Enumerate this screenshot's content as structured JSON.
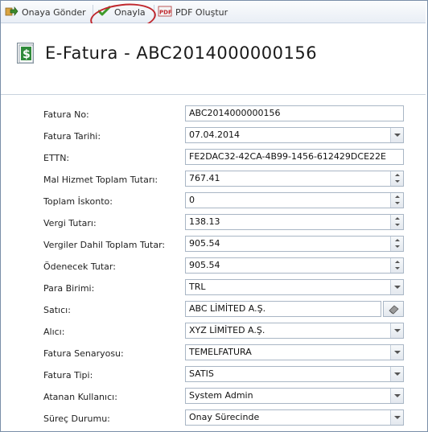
{
  "toolbar": {
    "send_label": "Onaya Gönder",
    "approve_label": "Onayla",
    "pdf_label": "PDF Oluştur"
  },
  "header": {
    "title": "E-Fatura - ABC2014000000156"
  },
  "form": {
    "fields": [
      {
        "label": "Fatura No:",
        "value": "ABC2014000000156",
        "control": "text"
      },
      {
        "label": "Fatura Tarihi:",
        "value": "07.04.2014",
        "control": "date-dropdown"
      },
      {
        "label": "ETTN:",
        "value": "FE2DAC32-42CA-4B99-1456-612429DCE22E",
        "control": "text"
      },
      {
        "label": "Mal Hizmet Toplam Tutarı:",
        "value": "767.41",
        "control": "numeric"
      },
      {
        "label": "Toplam İskonto:",
        "value": "0",
        "control": "numeric"
      },
      {
        "label": "Vergi Tutarı:",
        "value": "138.13",
        "control": "numeric"
      },
      {
        "label": "Vergiler Dahil Toplam Tutar:",
        "value": "905.54",
        "control": "numeric"
      },
      {
        "label": "Ödenecek Tutar:",
        "value": "905.54",
        "control": "numeric"
      },
      {
        "label": "Para Birimi:",
        "value": "TRL",
        "control": "dropdown"
      },
      {
        "label": "Satıcı:",
        "value": "ABC LİMİTED A.Ş.",
        "control": "picker"
      },
      {
        "label": "Alıcı:",
        "value": "XYZ LİMİTED A.Ş.",
        "control": "dropdown"
      },
      {
        "label": "Fatura Senaryosu:",
        "value": "TEMELFATURA",
        "control": "dropdown"
      },
      {
        "label": "Fatura Tipi:",
        "value": "SATIS",
        "control": "dropdown"
      },
      {
        "label": "Atanan Kullanıcı:",
        "value": "System Admin",
        "control": "dropdown"
      },
      {
        "label": "Süreç Durumu:",
        "value": "Onay Sürecinde",
        "control": "dropdown"
      }
    ]
  },
  "icons": {
    "send": "send-arrow-icon",
    "approve": "checkmark-icon",
    "pdf": "pdf-icon",
    "title": "invoice-dollar-icon",
    "picker": "eraser-icon"
  },
  "colors": {
    "highlight_circle": "#c0272d",
    "approve_check": "#3f9a2a",
    "title_icon": "#2f8a3a"
  }
}
